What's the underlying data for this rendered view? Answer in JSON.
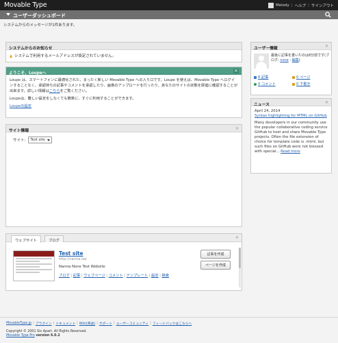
{
  "header": {
    "app_title": "Movable Type",
    "user_name": "Melody",
    "help": "ヘルプ",
    "sign_out": "サインアウト"
  },
  "titlebar": {
    "title": "ユーザーダッシュボード"
  },
  "system_message": "システムからのメッセージが1件あります。",
  "notice_widget": {
    "title": "システムからのお知らせ",
    "message": "システムで利用するメールアドレスが設定されていません。"
  },
  "welcome_widget": {
    "title": "ようこそ、Loupeへ",
    "para1_before": "Loupe は、スマートフォンに最適化された、まったく新しい Movable Type への入り口です。Loupe を使えば、Movable Type へログインすることなく、承認待ちの記事やコメントを承認したり、画像のアップロードを行ったり、あなたのサイトの状態を即座に確認することが出来ます。詳しい情報は",
    "para1_link": "こちら",
    "para1_after": "をご覧ください。",
    "para2": "Loupeは、難しい設定をしなくても簡単に、すぐに利用することができます。",
    "settings_link": "Loupeの設定"
  },
  "site_widget": {
    "title": "サイト情報",
    "site_label": "サイト:",
    "site_selected": "Test site"
  },
  "tabs_widget": {
    "tabs": [
      "ウェブサイト",
      "ブログ"
    ],
    "site_name": "Test site",
    "site_url": "http://narnia.na/",
    "site_description": "Narnia None Test Website",
    "links": [
      "ブログ",
      "記事",
      "ウェブページ",
      "コメント",
      "テンプレート",
      "設定",
      "検索"
    ],
    "buttons": {
      "create_entry": "記事を作成",
      "create_page": "ページを作成"
    }
  },
  "user_widget": {
    "title": "ユーザー情報",
    "last_post_prefix": "最後に記事を書いたのは8分前です(ブログ: ",
    "last_post_link": "none",
    "last_post_sep": " - ",
    "last_post_edit": "編集",
    "last_post_suffix": ")",
    "stats": [
      "6 記事",
      "0 ページ",
      "0 コメント",
      "0 下書き"
    ],
    "stat_colors": [
      "#3a7bd5",
      "#e0a020",
      "#2a9d5a",
      "#d9a520"
    ]
  },
  "news_widget": {
    "title": "ニュース",
    "date": "April 24, 2014",
    "headline": "Syntax highlighting for MTML on GitHub",
    "body": "Many developers in our community use the popular collaborative coding service GitHub to host and share Movable Type projects. Often the file extension of choice for template code is .mtml, but such files on GitHub were not blessed with special...",
    "read_more": "Read more"
  },
  "footer": {
    "links": [
      "MovableType.jp",
      "プラグイン",
      "ドキュメント",
      "Wiki(英語)",
      "サポート",
      "ユーザーコミュニティ",
      "フィードバックはこちらへ"
    ],
    "copyright": "Copyright © 2001 Six Apart. All Rights Reserved.",
    "product": "Movable Type Pro",
    "version": "version 6.0.2"
  },
  "colors": {
    "top_bar": "#1e1e1e",
    "title_bar": "#6f6f6f",
    "welcome_header": "#4f9e86",
    "link": "#1f5fb0",
    "warning": "#e8a317"
  },
  "icons": [
    "search-icon",
    "warning-icon",
    "close-icon",
    "user-avatar",
    "entry-icon",
    "page-icon",
    "comment-icon",
    "draft-icon"
  ]
}
